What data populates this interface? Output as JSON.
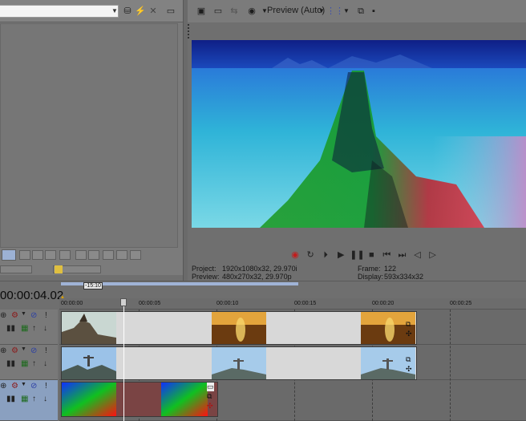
{
  "preview": {
    "mode_label": "Preview (Auto)",
    "project_label": "Project:",
    "project_value": "1920x1080x32, 29.970i",
    "preview_label": "Preview:",
    "preview_value": "480x270x32, 29.970p",
    "frame_label": "Frame:",
    "frame_value": "122",
    "display_label": "Display:",
    "display_value": "593x334x32"
  },
  "timeline": {
    "timecode": "00:00:04.02",
    "loop_label": "-15:10",
    "ruler_ticks": [
      "00:00:00",
      "00:00:05",
      "00:00:10",
      "00:00:15",
      "00:00:20",
      "00:00:25"
    ]
  },
  "icons": {
    "left_toolbar": [
      "favorites-icon",
      "lightning-icon",
      "close-icon",
      "monitor-icon"
    ],
    "preview_toolbar": [
      "properties-icon",
      "monitor-icon",
      "split-icon",
      "quality-icon",
      "grid-icon",
      "copy-icon",
      "save-icon"
    ],
    "transport": [
      "record-icon",
      "loop-icon",
      "play-from-start-icon",
      "play-icon",
      "pause-icon",
      "stop-icon",
      "prev-marker-icon",
      "next-marker-icon",
      "prev-frame-icon",
      "next-frame-icon"
    ]
  },
  "colors": {
    "selected_track": "#8aa0c0",
    "clip_bg": "#d8d8d8"
  }
}
